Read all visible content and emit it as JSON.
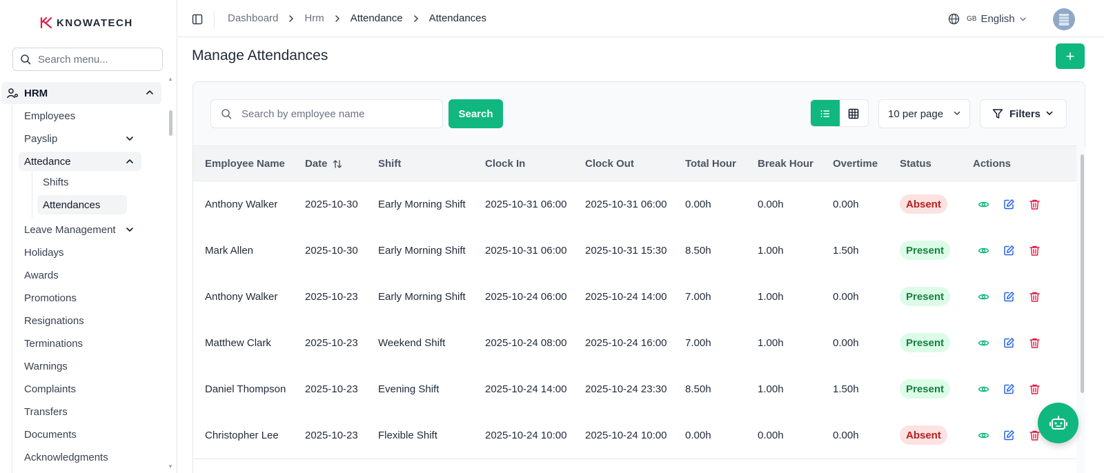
{
  "brand": {
    "name": "KNOWATECH",
    "accent": "#10b77f"
  },
  "sidebar": {
    "search_placeholder": "Search menu...",
    "group": {
      "label": "HRM",
      "icon": "user-cog-icon"
    },
    "items": [
      {
        "label": "Employees"
      },
      {
        "label": "Payslip",
        "expandable": true
      },
      {
        "label": "Attedance",
        "expanded": true,
        "children": [
          {
            "label": "Shifts"
          },
          {
            "label": "Attendances",
            "active": true
          }
        ]
      },
      {
        "label": "Leave Management",
        "expandable": true
      },
      {
        "label": "Holidays"
      },
      {
        "label": "Awards"
      },
      {
        "label": "Promotions"
      },
      {
        "label": "Resignations"
      },
      {
        "label": "Terminations"
      },
      {
        "label": "Warnings"
      },
      {
        "label": "Complaints"
      },
      {
        "label": "Transfers"
      },
      {
        "label": "Documents"
      },
      {
        "label": "Acknowledgments"
      }
    ]
  },
  "header": {
    "breadcrumb": [
      "Dashboard",
      "Hrm",
      "Attendance",
      "Attendances"
    ],
    "language": {
      "code": "GB",
      "name": "English"
    }
  },
  "page": {
    "title": "Manage Attendances",
    "search_placeholder": "Search by employee name",
    "search_label": "Search",
    "per_page": "10 per page",
    "filters_label": "Filters"
  },
  "table": {
    "columns": [
      "Employee Name",
      "Date",
      "Shift",
      "Clock In",
      "Clock Out",
      "Total Hour",
      "Break Hour",
      "Overtime",
      "Status",
      "Actions"
    ],
    "rows": [
      {
        "name": "Anthony Walker",
        "date": "2025-10-30",
        "shift": "Early Morning Shift",
        "clock_in": "2025-10-31 06:00",
        "clock_out": "2025-10-31 06:00",
        "total": "0.00h",
        "break": "0.00h",
        "overtime": "0.00h",
        "status": "Absent"
      },
      {
        "name": "Mark Allen",
        "date": "2025-10-30",
        "shift": "Early Morning Shift",
        "clock_in": "2025-10-31 06:00",
        "clock_out": "2025-10-31 15:30",
        "total": "8.50h",
        "break": "1.00h",
        "overtime": "1.50h",
        "status": "Present"
      },
      {
        "name": "Anthony Walker",
        "date": "2025-10-23",
        "shift": "Early Morning Shift",
        "clock_in": "2025-10-24 06:00",
        "clock_out": "2025-10-24 14:00",
        "total": "7.00h",
        "break": "1.00h",
        "overtime": "0.00h",
        "status": "Present"
      },
      {
        "name": "Matthew Clark",
        "date": "2025-10-23",
        "shift": "Weekend Shift",
        "clock_in": "2025-10-24 08:00",
        "clock_out": "2025-10-24 16:00",
        "total": "7.00h",
        "break": "1.00h",
        "overtime": "0.00h",
        "status": "Present"
      },
      {
        "name": "Daniel Thompson",
        "date": "2025-10-23",
        "shift": "Evening Shift",
        "clock_in": "2025-10-24 14:00",
        "clock_out": "2025-10-24 23:30",
        "total": "8.50h",
        "break": "1.00h",
        "overtime": "1.50h",
        "status": "Present"
      },
      {
        "name": "Christopher Lee",
        "date": "2025-10-23",
        "shift": "Flexible Shift",
        "clock_in": "2025-10-24 10:00",
        "clock_out": "2025-10-24 10:00",
        "total": "0.00h",
        "break": "0.00h",
        "overtime": "0.00h",
        "status": "Absent"
      }
    ]
  }
}
